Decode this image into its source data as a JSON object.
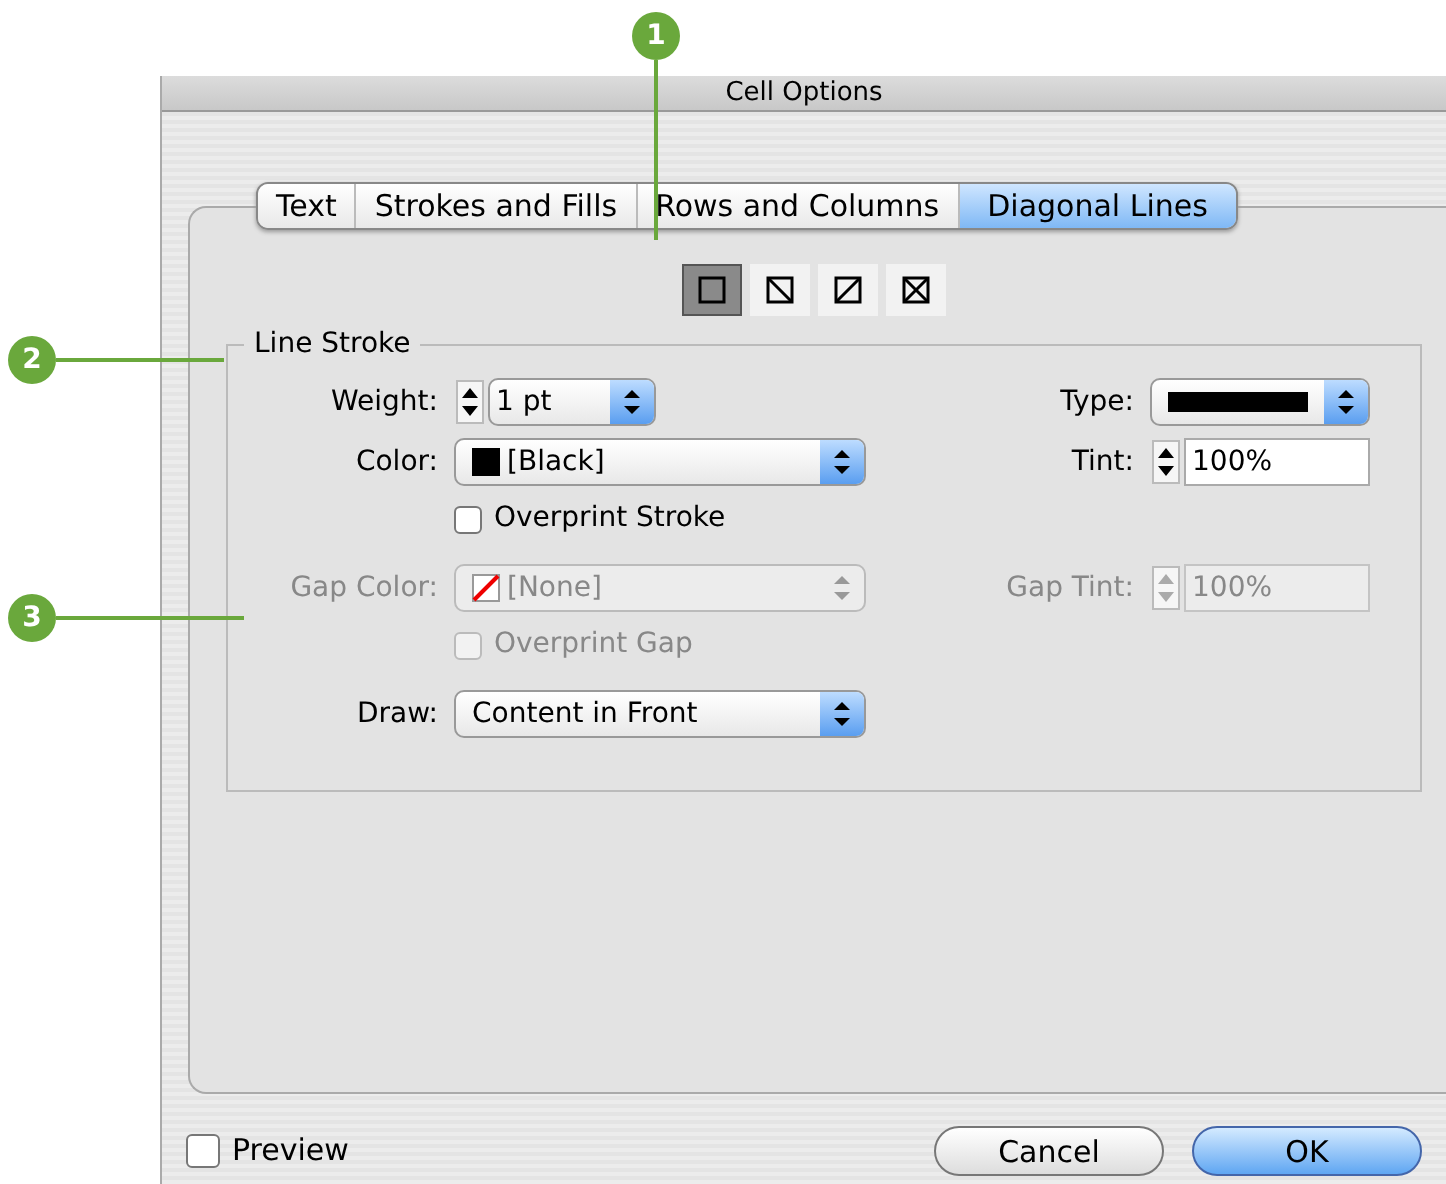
{
  "window": {
    "title": "Cell Options"
  },
  "callouts": [
    {
      "label": "1"
    },
    {
      "label": "2"
    },
    {
      "label": "3"
    }
  ],
  "tabs": [
    {
      "label": "Text",
      "selected": false
    },
    {
      "label": "Strokes and Fills",
      "selected": false
    },
    {
      "label": "Rows and Columns",
      "selected": false
    },
    {
      "label": "Diagonal Lines",
      "selected": true
    }
  ],
  "diagonal_buttons": [
    {
      "kind": "none",
      "selected": true
    },
    {
      "kind": "down",
      "selected": false
    },
    {
      "kind": "up",
      "selected": false
    },
    {
      "kind": "cross",
      "selected": false
    }
  ],
  "line_stroke": {
    "legend": "Line Stroke",
    "weight": {
      "label": "Weight:",
      "value": "1 pt"
    },
    "type": {
      "label": "Type:"
    },
    "color": {
      "label": "Color:",
      "value": "[Black]",
      "disabled": false
    },
    "tint": {
      "label": "Tint:",
      "value": "100%",
      "disabled": false
    },
    "overprint_stroke": {
      "label": "Overprint Stroke",
      "checked": false,
      "disabled": false
    },
    "gap_color": {
      "label": "Gap Color:",
      "value": "[None]",
      "disabled": true
    },
    "gap_tint": {
      "label": "Gap Tint:",
      "value": "100%",
      "disabled": true
    },
    "overprint_gap": {
      "label": "Overprint Gap",
      "checked": false,
      "disabled": true
    },
    "draw": {
      "label": "Draw:",
      "value": "Content in Front",
      "disabled": false
    }
  },
  "preview": {
    "label": "Preview",
    "checked": false
  },
  "buttons": [
    {
      "label": "Cancel",
      "kind": "cancel"
    },
    {
      "label": "OK",
      "kind": "default"
    }
  ]
}
